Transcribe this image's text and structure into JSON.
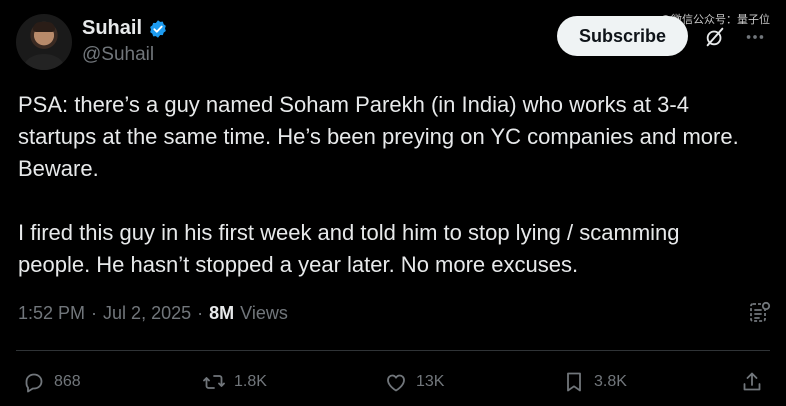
{
  "watermark": "@微信公众号：量子位",
  "author": {
    "display_name": "Suhail",
    "handle": "@Suhail"
  },
  "subscribe_label": "Subscribe",
  "post": {
    "paragraphs": [
      "PSA: there’s a guy named Soham Parekh (in India) who works at 3-4 startups at the same time. He’s been preying on YC companies and more. Beware.",
      "I fired this guy in his first week and told him to stop lying / scamming people. He hasn’t stopped a year later. No more excuses."
    ]
  },
  "meta": {
    "time": "1:52 PM",
    "separator1": "·",
    "date": "Jul 2, 2025",
    "separator2": "·",
    "views_count": "8M",
    "views_label": "Views"
  },
  "actions": {
    "replies": "868",
    "reposts": "1.8K",
    "likes": "13K",
    "bookmarks": "3.8K"
  },
  "icons": [
    "verified-badge-icon",
    "grok-icon",
    "more-icon",
    "analytics-icon",
    "reply-icon",
    "repost-icon",
    "like-icon",
    "bookmark-icon",
    "share-icon"
  ],
  "colors": {
    "background": "#000000",
    "text": "#e7e9ea",
    "secondary": "#71767b",
    "verified": "#1d9bf0",
    "button_bg": "#eff3f4"
  }
}
